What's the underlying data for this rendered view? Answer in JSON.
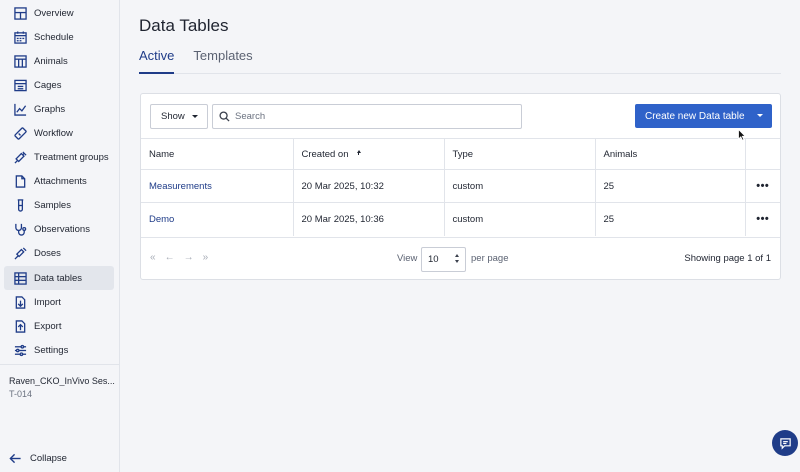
{
  "sidebar": {
    "items": [
      {
        "label": "Overview",
        "icon": "overview-icon"
      },
      {
        "label": "Schedule",
        "icon": "calendar-icon"
      },
      {
        "label": "Animals",
        "icon": "table-icon"
      },
      {
        "label": "Cages",
        "icon": "cage-icon"
      },
      {
        "label": "Graphs",
        "icon": "graph-icon"
      },
      {
        "label": "Workflow",
        "icon": "workflow-icon"
      },
      {
        "label": "Treatment groups",
        "icon": "syringe-icon"
      },
      {
        "label": "Attachments",
        "icon": "file-icon"
      },
      {
        "label": "Samples",
        "icon": "test-tube-icon"
      },
      {
        "label": "Observations",
        "icon": "stethoscope-icon"
      },
      {
        "label": "Doses",
        "icon": "dose-icon"
      },
      {
        "label": "Data tables",
        "icon": "data-table-icon",
        "active": true
      },
      {
        "label": "Import",
        "icon": "import-icon"
      },
      {
        "label": "Export",
        "icon": "export-icon"
      },
      {
        "label": "Settings",
        "icon": "sliders-icon"
      }
    ],
    "study_name": "Raven_CKO_InVivo Ses...",
    "study_id": "T-014",
    "collapse_label": "Collapse"
  },
  "page": {
    "title": "Data Tables",
    "tabs": [
      {
        "label": "Active",
        "active": true
      },
      {
        "label": "Templates",
        "active": false
      }
    ]
  },
  "toolbar": {
    "show_label": "Show",
    "search_placeholder": "Search",
    "create_label": "Create new Data table"
  },
  "table": {
    "headers": [
      "Name",
      "Created on",
      "Type",
      "Animals"
    ],
    "rows": [
      {
        "name": "Measurements",
        "created_on": "20 Mar 2025, 10:32",
        "type": "custom",
        "animals": "25"
      },
      {
        "name": "Demo",
        "created_on": "20 Mar 2025, 10:36",
        "type": "custom",
        "animals": "25"
      }
    ],
    "more_label": "•••"
  },
  "pagination": {
    "first": "«",
    "prev": "←",
    "next": "→",
    "last": "»",
    "view_label": "View",
    "per_page_value": "10",
    "per_page_label": "per page",
    "showing": "Showing page 1 of 1"
  },
  "colors": {
    "accent": "#1f3c88",
    "primary_button": "#2f62c9",
    "background": "#f4f5f8"
  }
}
